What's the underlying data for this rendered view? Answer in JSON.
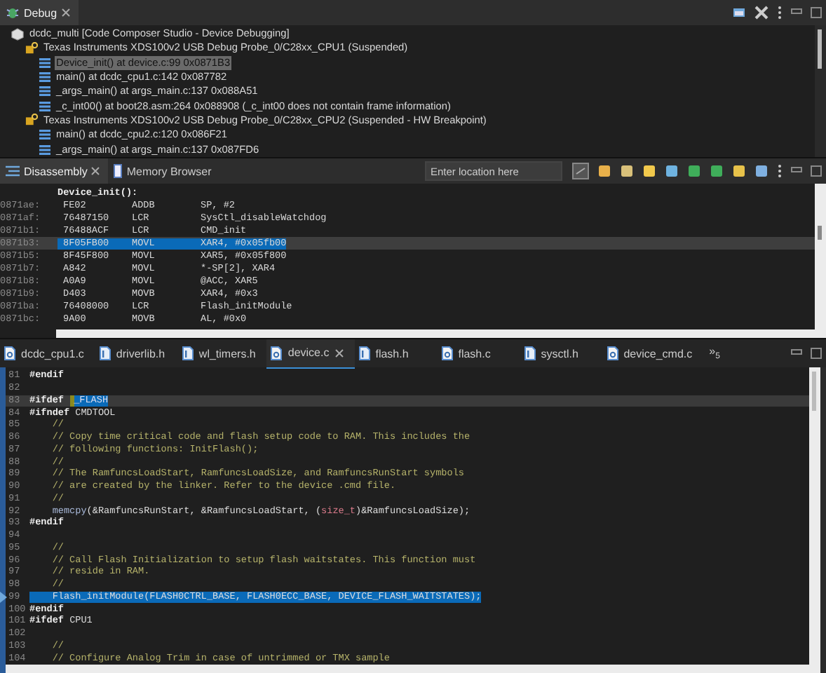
{
  "debug_view": {
    "tab": {
      "label": "Debug",
      "selected": true
    },
    "tree": [
      {
        "label": "dcdc_multi [Code Composer Studio - Device Debugging]",
        "kind": "session",
        "children": [
          {
            "label": "Texas Instruments XDS100v2 USB Debug Probe_0/C28xx_CPU1 (Suspended)",
            "kind": "thread",
            "children": [
              {
                "label": "Device_init() at device.c:99 0x0871B3",
                "kind": "frame",
                "selected": true
              },
              {
                "label": "main() at dcdc_cpu1.c:142 0x087782",
                "kind": "frame",
                "selected": false
              },
              {
                "label": "_args_main() at args_main.c:137 0x088A51",
                "kind": "frame",
                "selected": false
              },
              {
                "label": "_c_int00() at boot28.asm:264 0x088908  (_c_int00 does not contain frame information)",
                "kind": "frame",
                "selected": false
              }
            ]
          },
          {
            "label": "Texas Instruments XDS100v2 USB Debug Probe_0/C28xx_CPU2 (Suspended - HW Breakpoint)",
            "kind": "thread",
            "children": [
              {
                "label": "main() at dcdc_cpu2.c:120 0x086F21",
                "kind": "frame",
                "selected": false
              },
              {
                "label": "_args_main() at args_main.c:137 0x087FD6",
                "kind": "frame",
                "selected": false
              }
            ]
          }
        ]
      }
    ]
  },
  "disassembly_view": {
    "tabs": [
      {
        "label": "Disassembly",
        "selected": true
      },
      {
        "label": "Memory Browser",
        "selected": false
      }
    ],
    "location_field": {
      "placeholder": "Enter location here"
    },
    "function_label": "Device_init():",
    "rows": [
      {
        "address": "0871ae:",
        "opcode": "FE02",
        "mnemonic": "ADDB",
        "operands": "SP, #2",
        "selected": false
      },
      {
        "address": "0871af:",
        "opcode": "76487150",
        "mnemonic": "LCR",
        "operands": "SysCtl_disableWatchdog",
        "selected": false
      },
      {
        "address": "0871b1:",
        "opcode": "76488ACF",
        "mnemonic": "LCR",
        "operands": "CMD_init",
        "selected": false
      },
      {
        "address": "0871b3:",
        "opcode": "8F05FB00",
        "mnemonic": "MOVL",
        "operands": "XAR4, #0x05fb00",
        "selected": true
      },
      {
        "address": "0871b5:",
        "opcode": "8F45F800",
        "mnemonic": "MOVL",
        "operands": "XAR5, #0x05f800",
        "selected": false
      },
      {
        "address": "0871b7:",
        "opcode": "A842",
        "mnemonic": "MOVL",
        "operands": "*-SP[2], XAR4",
        "selected": false
      },
      {
        "address": "0871b8:",
        "opcode": "A0A9",
        "mnemonic": "MOVL",
        "operands": "@ACC, XAR5",
        "selected": false
      },
      {
        "address": "0871b9:",
        "opcode": "D403",
        "mnemonic": "MOVB",
        "operands": "XAR4, #0x3",
        "selected": false
      },
      {
        "address": "0871ba:",
        "opcode": "76408000",
        "mnemonic": "LCR",
        "operands": "Flash_initModule",
        "selected": false
      },
      {
        "address": "0871bc:",
        "opcode": "9A00",
        "mnemonic": "MOVB",
        "operands": "AL, #0x0",
        "selected": false
      }
    ]
  },
  "editor": {
    "tabs": [
      {
        "label": "dcdc_cpu1.c",
        "kind": "c",
        "selected": false
      },
      {
        "label": "driverlib.h",
        "kind": "h",
        "selected": false
      },
      {
        "label": "wl_timers.h",
        "kind": "h",
        "selected": false
      },
      {
        "label": "device.c",
        "kind": "c",
        "selected": true
      },
      {
        "label": "flash.h",
        "kind": "h",
        "selected": false
      },
      {
        "label": "flash.c",
        "kind": "c",
        "selected": false
      },
      {
        "label": "sysctl.h",
        "kind": "h",
        "selected": false
      },
      {
        "label": "device_cmd.c",
        "kind": "c",
        "selected": false
      }
    ],
    "overflow": {
      "arrows": "»",
      "count": "5"
    },
    "lines": [
      {
        "number": "81",
        "current": false,
        "selected": false,
        "segments": [
          {
            "text": "#endif",
            "kind": "directive"
          }
        ]
      },
      {
        "number": "82",
        "current": false,
        "selected": false
      },
      {
        "number": "83",
        "current": true,
        "selected": false,
        "segments": [
          {
            "text": "#ifdef ",
            "kind": "directive"
          },
          {
            "text": "_FLASH",
            "kind": "selection"
          }
        ]
      },
      {
        "number": "84",
        "current": false,
        "selected": false,
        "segments": [
          {
            "text": "#ifndef ",
            "kind": "directive"
          },
          {
            "text": "CMDTOOL",
            "kind": "code"
          }
        ]
      },
      {
        "number": "85",
        "current": false,
        "selected": false,
        "segments": [
          {
            "text": "    //",
            "kind": "comment"
          }
        ]
      },
      {
        "number": "86",
        "current": false,
        "selected": false,
        "segments": [
          {
            "text": "    // Copy time critical code and flash setup code to RAM. This includes the",
            "kind": "comment"
          }
        ]
      },
      {
        "number": "87",
        "current": false,
        "selected": false,
        "segments": [
          {
            "text": "    // following functions: InitFlash();",
            "kind": "comment"
          }
        ]
      },
      {
        "number": "88",
        "current": false,
        "selected": false,
        "segments": [
          {
            "text": "    //",
            "kind": "comment"
          }
        ]
      },
      {
        "number": "89",
        "current": false,
        "selected": false,
        "segments": [
          {
            "text": "    // The RamfuncsLoadStart, RamfuncsLoadSize, and RamfuncsRunStart symbols",
            "kind": "comment"
          }
        ]
      },
      {
        "number": "90",
        "current": false,
        "selected": false,
        "segments": [
          {
            "text": "    // are created by the linker. Refer to the device .cmd file.",
            "kind": "comment"
          }
        ]
      },
      {
        "number": "91",
        "current": false,
        "selected": false,
        "segments": [
          {
            "text": "    //",
            "kind": "comment"
          }
        ]
      },
      {
        "number": "92",
        "current": false,
        "selected": false,
        "segments": [
          {
            "text": "    memcpy",
            "kind": "function"
          },
          {
            "text": "(&RamfuncsRunStart, &RamfuncsLoadStart, (",
            "kind": "code"
          },
          {
            "text": "size_t",
            "kind": "type"
          },
          {
            "text": ")&RamfuncsLoadSize);",
            "kind": "code"
          }
        ]
      },
      {
        "number": "93",
        "current": false,
        "selected": false,
        "segments": [
          {
            "text": "#endif",
            "kind": "directive"
          }
        ]
      },
      {
        "number": "94",
        "current": false,
        "selected": false
      },
      {
        "number": "95",
        "current": false,
        "selected": false,
        "segments": [
          {
            "text": "    //",
            "kind": "comment"
          }
        ]
      },
      {
        "number": "96",
        "current": false,
        "selected": false,
        "segments": [
          {
            "text": "    // Call Flash Initialization to setup flash waitstates. This function must",
            "kind": "comment"
          }
        ]
      },
      {
        "number": "97",
        "current": false,
        "selected": false,
        "segments": [
          {
            "text": "    // reside in RAM.",
            "kind": "comment"
          }
        ]
      },
      {
        "number": "98",
        "current": false,
        "selected": false,
        "segments": [
          {
            "text": "    //",
            "kind": "comment"
          }
        ]
      },
      {
        "number": "99",
        "current": false,
        "selected": true,
        "segments": [
          {
            "text": "    Flash_initModule(FLASH0CTRL_BASE, FLASH0ECC_BASE, DEVICE_FLASH_WAITSTATES);",
            "kind": "code"
          }
        ]
      },
      {
        "number": "100",
        "current": false,
        "selected": false,
        "segments": [
          {
            "text": "#endif",
            "kind": "directive"
          }
        ]
      },
      {
        "number": "101",
        "current": false,
        "selected": false,
        "segments": [
          {
            "text": "#ifdef ",
            "kind": "directive"
          },
          {
            "text": "CPU1",
            "kind": "code"
          }
        ]
      },
      {
        "number": "102",
        "current": false,
        "selected": false
      },
      {
        "number": "103",
        "current": false,
        "selected": false,
        "segments": [
          {
            "text": "    //",
            "kind": "comment"
          }
        ]
      },
      {
        "number": "104",
        "current": false,
        "selected": false,
        "segments": [
          {
            "text": "    // Configure Analog Trim in case of untrimmed or TMX sample",
            "kind": "comment"
          }
        ]
      }
    ]
  }
}
